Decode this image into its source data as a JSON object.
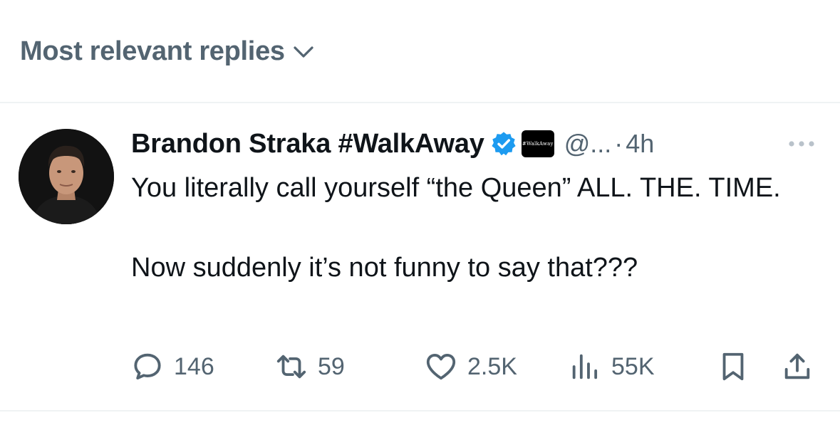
{
  "sort": {
    "label": "Most relevant replies"
  },
  "post": {
    "author_name": "Brandon Straka #WalkAway",
    "affiliate_badge_text": "#WalkAway",
    "handle": "@...",
    "separator": "·",
    "time": "4h",
    "lines": [
      "You literally call yourself “the Queen” ALL. THE. TIME.",
      "Now suddenly it’s not funny to say that???"
    ]
  },
  "actions": {
    "replies": "146",
    "reposts": "59",
    "likes": "2.5K",
    "views": "55K"
  },
  "icons": [
    "chevron-down-icon",
    "verified-badge-icon",
    "more-icon",
    "reply-icon",
    "repost-icon",
    "like-icon",
    "views-icon",
    "bookmark-icon",
    "share-icon"
  ],
  "colors": {
    "text": "#0f1419",
    "secondary": "#536471",
    "verified": "#1d9bf0",
    "divider": "#eff3f4"
  }
}
